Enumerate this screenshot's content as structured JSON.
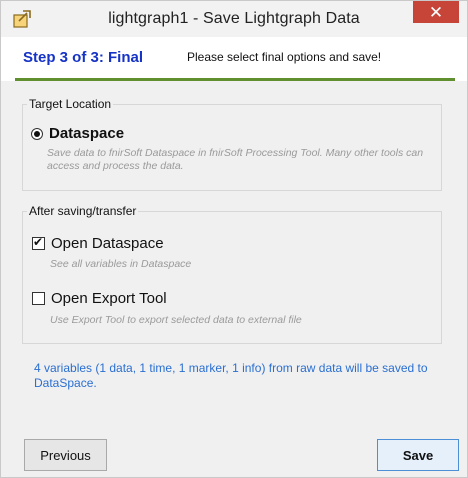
{
  "window": {
    "title": "lightgraph1 - Save Lightgraph Data",
    "close_label": "✕"
  },
  "header": {
    "step_title": "Step 3 of 3: Final",
    "hint": "Please select final options and save!"
  },
  "target_location": {
    "legend": "Target Location",
    "option_label": "Dataspace",
    "option_selected": true,
    "description": "Save data to fnirSoft Dataspace in fnirSoft Processing Tool. Many other tools can access and process the data."
  },
  "after_saving": {
    "legend": "After saving/transfer",
    "open_dataspace": {
      "label": "Open Dataspace",
      "checked": true,
      "description": "See all variables in Dataspace"
    },
    "open_export_tool": {
      "label": "Open Export Tool",
      "checked": false,
      "description": "Use Export Tool to export selected data to external file"
    }
  },
  "status_text": "4 variables (1 data, 1 time, 1 marker, 1 info) from raw data will be saved to DataSpace.",
  "buttons": {
    "previous": "Previous",
    "save": "Save"
  },
  "colors": {
    "step_title": "#1533c6",
    "accent_rule": "#5f8f2e",
    "status_text": "#2a6fd1",
    "close_button": "#c74438"
  },
  "icons": {
    "app_icon": "export-arrow-icon"
  }
}
